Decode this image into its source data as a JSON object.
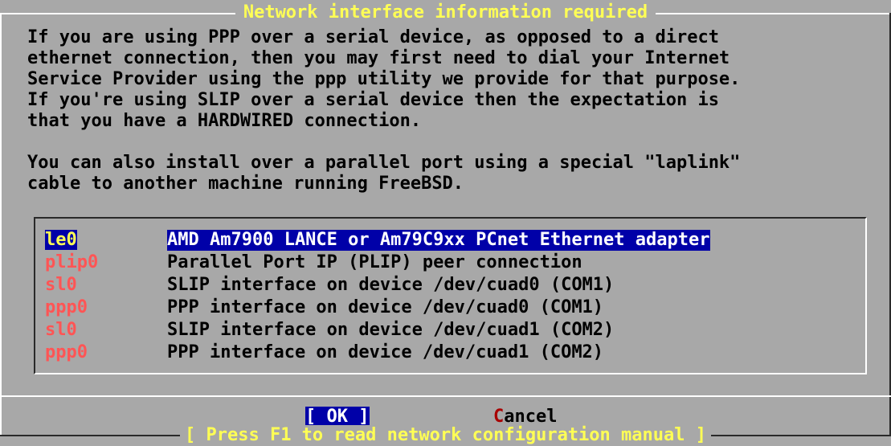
{
  "dialog": {
    "title": "Network interface information required",
    "intro_text": "If you are using PPP over a serial device, as opposed to a direct\nethernet connection, then you may first need to dial your Internet\nService Provider using the ppp utility we provide for that purpose.\nIf you're using SLIP over a serial device then the expectation is\nthat you have a HARDWIRED connection.\n\nYou can also install over a parallel port using a special \"laplink\"\ncable to another machine running FreeBSD.",
    "interfaces": [
      {
        "device": "le0",
        "description": "AMD Am7900 LANCE or Am79C9xx PCnet Ethernet adapter",
        "selected": true
      },
      {
        "device": "plip0",
        "description": "Parallel Port IP (PLIP) peer connection",
        "selected": false
      },
      {
        "device": "sl0",
        "description": "SLIP interface on device /dev/cuad0 (COM1)",
        "selected": false
      },
      {
        "device": "ppp0",
        "description": "PPP interface on device /dev/cuad0 (COM1)",
        "selected": false
      },
      {
        "device": "sl0",
        "description": "SLIP interface on device /dev/cuad1 (COM2)",
        "selected": false
      },
      {
        "device": "ppp0",
        "description": "PPP interface on device /dev/cuad1 (COM2)",
        "selected": false
      }
    ],
    "buttons": {
      "ok_left": "[ ",
      "ok_label": "OK",
      "ok_right": " ]",
      "cancel_hotkey": "C",
      "cancel_rest": "ancel"
    },
    "footer": "[ Press F1 to read network configuration manual ]"
  },
  "colors": {
    "background": "#a8a8a8",
    "title_fg": "#ffff55",
    "highlight_bg": "#0000a8",
    "device_fg": "#ff5555",
    "hotkey_fg": "#a80000"
  }
}
